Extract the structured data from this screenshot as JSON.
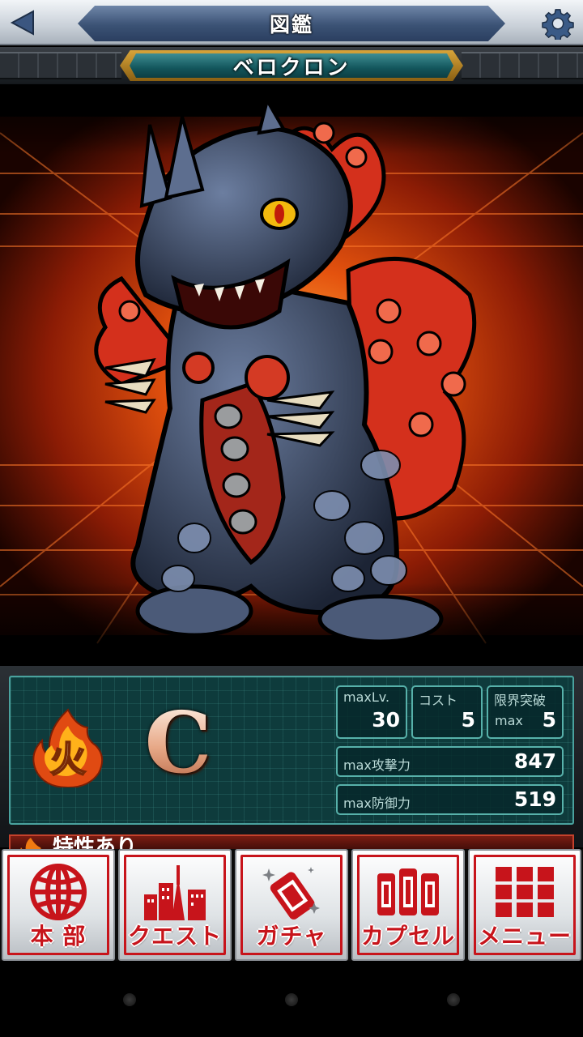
{
  "header": {
    "title": "図鑑",
    "back_icon": "back-arrow-icon",
    "settings_icon": "gear-icon"
  },
  "monster": {
    "name": "ベロクロン",
    "element_label": "火",
    "rank": "C"
  },
  "stats": {
    "max_level_label": "maxLv.",
    "max_level": "30",
    "cost_label": "コスト",
    "cost": "5",
    "limit_break_label": "限界突破",
    "limit_break_sub": "max",
    "limit_break": "5",
    "max_attack_label": "max攻撃力",
    "max_attack": "847",
    "max_defense_label": "max防御力",
    "max_defense": "519"
  },
  "teaser": {
    "text": "特性あり"
  },
  "nav": {
    "items": [
      {
        "label": "本 部",
        "icon": "globe-icon"
      },
      {
        "label": "クエスト",
        "icon": "city-icon"
      },
      {
        "label": "ガチャ",
        "icon": "capsule-sparkle-icon"
      },
      {
        "label": "カプセル",
        "icon": "capsules-icon"
      },
      {
        "label": "メニュー",
        "icon": "grid-menu-icon"
      }
    ]
  },
  "colors": {
    "accent_red": "#c7141b",
    "panel_teal": "#0e3b3c",
    "title_blue": "#3b5275"
  }
}
